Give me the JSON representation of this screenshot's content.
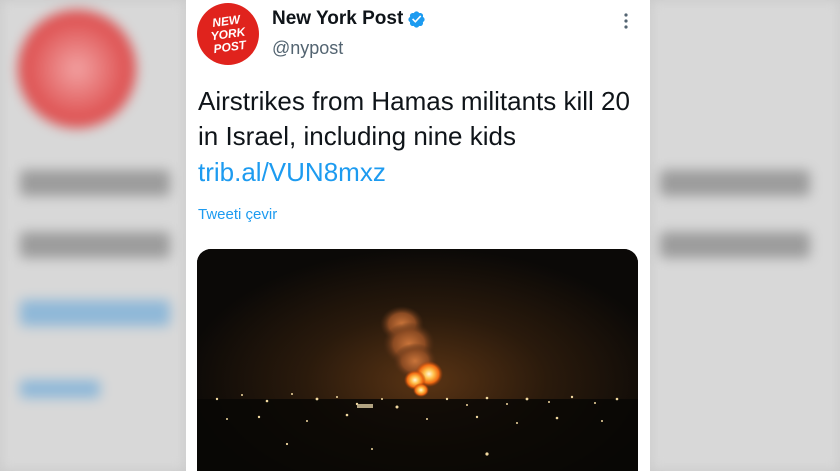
{
  "account": {
    "name": "New York Post",
    "handle": "@nypost",
    "logo_text": "NEW YORK POST",
    "verified": true,
    "avatar_color": "#e0231d"
  },
  "tweet": {
    "text": "Airstrikes from Hamas militants kill 20 in Israel, including nine kids",
    "link": "trib.al/VUN8mxz",
    "translate_label": "Tweeti çevir"
  },
  "media": {
    "icon": "night-explosion-photo"
  },
  "icons": {
    "verified": "verified-badge-icon",
    "more": "more-options-icon"
  },
  "colors": {
    "link": "#1d9bf0",
    "text": "#0f1419",
    "muted": "#536471"
  }
}
